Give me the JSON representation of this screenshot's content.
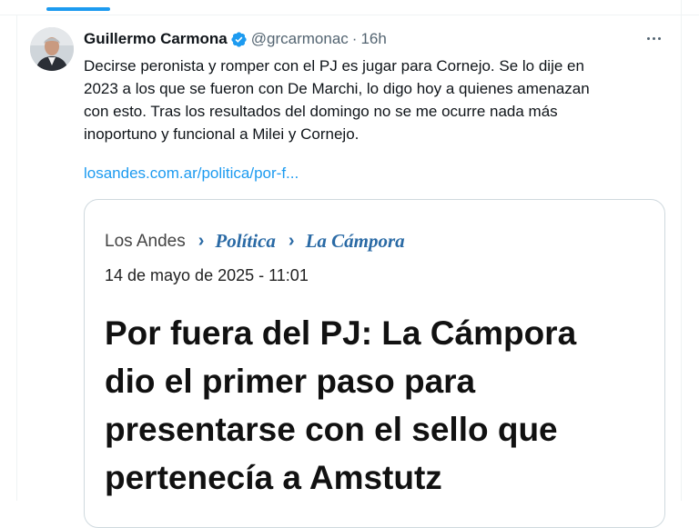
{
  "tweet": {
    "author_name": "Guillermo Carmona",
    "handle": "@grcarmonac",
    "separator": "·",
    "time": "16h",
    "text_lines": [
      "Decirse peronista y romper con el PJ es jugar para Cornejo. Se lo dije en",
      "2023 a los que se fueron con De Marchi, lo digo hoy a  quienes amenazan",
      "con esto. Tras los resultados del domingo no se me ocurre nada más",
      "inoportuno y funcional a Milei y Cornejo."
    ],
    "link_text": "losandes.com.ar/politica/por-f..."
  },
  "card": {
    "source": "Los Andes",
    "section_1": "Política",
    "section_2": "La Cámpora",
    "date": "14 de mayo de 2025 - 11:01",
    "headline_lines": [
      "Por fuera del PJ: La Cámpora",
      "dio el primer paso para",
      "presentarse con el sello que",
      "pertenecía a Amstutz"
    ]
  },
  "colors": {
    "accent": "#1d9bf0",
    "section": "#2a6aa5",
    "muted": "#536471"
  },
  "icons": {
    "verified": "verified-badge-icon",
    "more": "more-options-icon",
    "breadcrumb": "chevron-right-icon"
  }
}
